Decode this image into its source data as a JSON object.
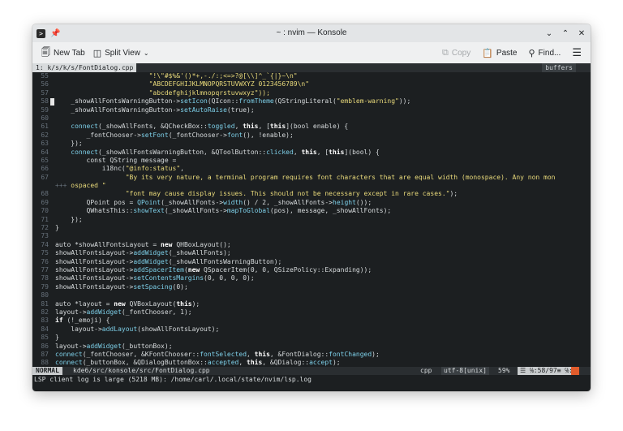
{
  "window": {
    "title": "~ : nvim — Konsole"
  },
  "toolbar": {
    "new_tab": "New Tab",
    "split_view": "Split View",
    "copy": "Copy",
    "paste": "Paste",
    "find": "Find..."
  },
  "tabline": {
    "active_tab": "1: k/s/k/s/FontDialog.cpp",
    "right_label": "buffers"
  },
  "editor": {
    "lines": [
      {
        "num": "55",
        "parts": [
          {
            "c": "str",
            "t": "                        \"!\\\"#$%&'()*+,-./:;<=>?@[\\\\]^_`{|}~\\n\""
          }
        ]
      },
      {
        "num": "56",
        "parts": [
          {
            "c": "str",
            "t": "                        \"ABCDEFGHIJKLMNOPQRSTUVWXYZ 0123456789\\n\""
          }
        ]
      },
      {
        "num": "57",
        "parts": [
          {
            "c": "str",
            "t": "                        \"abcdefghijklmnopqrstuvwxyz\"));"
          }
        ]
      },
      {
        "num": "58",
        "parts": [
          {
            "c": "txt",
            "t": "    _showAllFontsWarningButton->"
          },
          {
            "c": "fn",
            "t": "setIcon"
          },
          {
            "c": "txt",
            "t": "(QIcon::"
          },
          {
            "c": "fn",
            "t": "fromTheme"
          },
          {
            "c": "txt",
            "t": "(QStringLiteral("
          },
          {
            "c": "str",
            "t": "\"emblem-warning\""
          },
          {
            "c": "txt",
            "t": "));"
          }
        ]
      },
      {
        "num": "59",
        "parts": [
          {
            "c": "txt",
            "t": "    _showAllFontsWarningButton->"
          },
          {
            "c": "fn",
            "t": "setAutoRaise"
          },
          {
            "c": "txt",
            "t": "(true);"
          }
        ]
      },
      {
        "num": "60",
        "parts": []
      },
      {
        "num": "61",
        "parts": [
          {
            "c": "fn",
            "t": "    connect"
          },
          {
            "c": "txt",
            "t": "(_showAllFonts, &QCheckBox::"
          },
          {
            "c": "fn",
            "t": "toggled"
          },
          {
            "c": "txt",
            "t": ", "
          },
          {
            "c": "kw",
            "t": "this"
          },
          {
            "c": "txt",
            "t": ", ["
          },
          {
            "c": "kw",
            "t": "this"
          },
          {
            "c": "txt",
            "t": "](bool enable) {"
          }
        ]
      },
      {
        "num": "62",
        "parts": [
          {
            "c": "txt",
            "t": "        _fontChooser->"
          },
          {
            "c": "fn",
            "t": "setFont"
          },
          {
            "c": "txt",
            "t": "(_fontChooser->"
          },
          {
            "c": "fn",
            "t": "font"
          },
          {
            "c": "txt",
            "t": "(), !enable);"
          }
        ]
      },
      {
        "num": "63",
        "parts": [
          {
            "c": "txt",
            "t": "    });"
          }
        ]
      },
      {
        "num": "64",
        "parts": [
          {
            "c": "fn",
            "t": "    connect"
          },
          {
            "c": "txt",
            "t": "(_showAllFontsWarningButton, &QToolButton::"
          },
          {
            "c": "fn",
            "t": "clicked"
          },
          {
            "c": "txt",
            "t": ", "
          },
          {
            "c": "kw",
            "t": "this"
          },
          {
            "c": "txt",
            "t": ", ["
          },
          {
            "c": "kw",
            "t": "this"
          },
          {
            "c": "txt",
            "t": "](bool) {"
          }
        ]
      },
      {
        "num": "65",
        "parts": [
          {
            "c": "txt",
            "t": "        const QString message ="
          }
        ]
      },
      {
        "num": "66",
        "parts": [
          {
            "c": "txt",
            "t": "            i18nc("
          },
          {
            "c": "str",
            "t": "\"@info:status\""
          },
          {
            "c": "txt",
            "t": ","
          }
        ]
      },
      {
        "num": "67",
        "parts": [
          {
            "c": "str",
            "t": "                  \"By its very nature, a terminal program requires font characters that are equal width (monospace). Any non mon"
          }
        ]
      },
      {
        "num": "",
        "wrap": true,
        "parts": [
          {
            "c": "wrap-mark",
            "t": "+++ "
          },
          {
            "c": "str",
            "t": "ospaced \""
          }
        ]
      },
      {
        "num": "68",
        "parts": [
          {
            "c": "str",
            "t": "                  \"font may cause display issues. This should not be necessary except in rare cases.\""
          },
          {
            "c": "txt",
            "t": ");"
          }
        ]
      },
      {
        "num": "69",
        "parts": [
          {
            "c": "txt",
            "t": "        QPoint pos = "
          },
          {
            "c": "fn",
            "t": "QPoint"
          },
          {
            "c": "txt",
            "t": "(_showAllFonts->"
          },
          {
            "c": "fn",
            "t": "width"
          },
          {
            "c": "txt",
            "t": "() / 2, _showAllFonts->"
          },
          {
            "c": "fn",
            "t": "height"
          },
          {
            "c": "txt",
            "t": "());"
          }
        ]
      },
      {
        "num": "70",
        "parts": [
          {
            "c": "txt",
            "t": "        QWhatsThis::"
          },
          {
            "c": "fn",
            "t": "showText"
          },
          {
            "c": "txt",
            "t": "(_showAllFonts->"
          },
          {
            "c": "fn",
            "t": "mapToGlobal"
          },
          {
            "c": "txt",
            "t": "(pos), message, _showAllFonts);"
          }
        ]
      },
      {
        "num": "71",
        "parts": [
          {
            "c": "txt",
            "t": "    });"
          }
        ]
      },
      {
        "num": "72",
        "parts": [
          {
            "c": "txt",
            "t": "}"
          }
        ]
      },
      {
        "num": "73",
        "parts": []
      },
      {
        "num": "74",
        "parts": [
          {
            "c": "txt",
            "t": "auto *showAllFontsLayout = "
          },
          {
            "c": "kw",
            "t": "new"
          },
          {
            "c": "txt",
            "t": " QHBoxLayout();"
          }
        ]
      },
      {
        "num": "75",
        "parts": [
          {
            "c": "txt",
            "t": "showAllFontsLayout->"
          },
          {
            "c": "fn",
            "t": "addWidget"
          },
          {
            "c": "txt",
            "t": "(_showAllFonts);"
          }
        ]
      },
      {
        "num": "76",
        "parts": [
          {
            "c": "txt",
            "t": "showAllFontsLayout->"
          },
          {
            "c": "fn",
            "t": "addWidget"
          },
          {
            "c": "txt",
            "t": "(_showAllFontsWarningButton);"
          }
        ]
      },
      {
        "num": "77",
        "parts": [
          {
            "c": "txt",
            "t": "showAllFontsLayout->"
          },
          {
            "c": "fn",
            "t": "addSpacerItem"
          },
          {
            "c": "txt",
            "t": "("
          },
          {
            "c": "kw",
            "t": "new"
          },
          {
            "c": "txt",
            "t": " QSpacerItem(0, 0, QSizePolicy::Expanding));"
          }
        ]
      },
      {
        "num": "78",
        "parts": [
          {
            "c": "txt",
            "t": "showAllFontsLayout->"
          },
          {
            "c": "fn",
            "t": "setContentsMargins"
          },
          {
            "c": "txt",
            "t": "(0, 0, 0, 0);"
          }
        ]
      },
      {
        "num": "79",
        "parts": [
          {
            "c": "txt",
            "t": "showAllFontsLayout->"
          },
          {
            "c": "fn",
            "t": "setSpacing"
          },
          {
            "c": "txt",
            "t": "(0);"
          }
        ]
      },
      {
        "num": "80",
        "parts": []
      },
      {
        "num": "81",
        "parts": [
          {
            "c": "txt",
            "t": "auto *layout = "
          },
          {
            "c": "kw",
            "t": "new"
          },
          {
            "c": "txt",
            "t": " QVBoxLayout("
          },
          {
            "c": "kw",
            "t": "this"
          },
          {
            "c": "txt",
            "t": ");"
          }
        ]
      },
      {
        "num": "82",
        "parts": [
          {
            "c": "txt",
            "t": "layout->"
          },
          {
            "c": "fn",
            "t": "addWidget"
          },
          {
            "c": "txt",
            "t": "(_fontChooser, 1);"
          }
        ]
      },
      {
        "num": "83",
        "parts": [
          {
            "c": "kw",
            "t": "if"
          },
          {
            "c": "txt",
            "t": " (!_emoji) {"
          }
        ]
      },
      {
        "num": "84",
        "parts": [
          {
            "c": "txt",
            "t": "    layout->"
          },
          {
            "c": "fn",
            "t": "addLayout"
          },
          {
            "c": "txt",
            "t": "(showAllFontsLayout);"
          }
        ]
      },
      {
        "num": "85",
        "parts": [
          {
            "c": "txt",
            "t": "}"
          }
        ]
      },
      {
        "num": "86",
        "parts": [
          {
            "c": "txt",
            "t": "layout->"
          },
          {
            "c": "fn",
            "t": "addWidget"
          },
          {
            "c": "txt",
            "t": "(_buttonBox);"
          }
        ]
      },
      {
        "num": "87",
        "parts": [
          {
            "c": "fn",
            "t": "connect"
          },
          {
            "c": "txt",
            "t": "(_fontChooser, &KFontChooser::"
          },
          {
            "c": "fn",
            "t": "fontSelected"
          },
          {
            "c": "txt",
            "t": ", "
          },
          {
            "c": "kw",
            "t": "this"
          },
          {
            "c": "txt",
            "t": ", &FontDialog::"
          },
          {
            "c": "fn",
            "t": "fontChanged"
          },
          {
            "c": "txt",
            "t": ");"
          }
        ]
      },
      {
        "num": "88",
        "parts": [
          {
            "c": "fn",
            "t": "connect"
          },
          {
            "c": "txt",
            "t": "(_buttonBox, &QDialogButtonBox::"
          },
          {
            "c": "fn",
            "t": "accepted"
          },
          {
            "c": "txt",
            "t": ", "
          },
          {
            "c": "kw",
            "t": "this"
          },
          {
            "c": "txt",
            "t": ", &QDialog::"
          },
          {
            "c": "fn",
            "t": "accept"
          },
          {
            "c": "txt",
            "t": ");"
          }
        ]
      }
    ]
  },
  "statusline": {
    "mode": "NORMAL",
    "file": "kde6/src/konsole/src/FontDialog.cpp",
    "filetype": "cpp",
    "encoding": "utf-8[unix]",
    "percent": "59%",
    "position": "☰ ℅:58/97≡ ℅:1"
  },
  "cmdline": "LSP client log is large (5218 MB): /home/carl/.local/state/nvim/lsp.log",
  "icons": {
    "app": "konsole-icon",
    "pin": "pin-icon",
    "new_tab": "new-tab-icon",
    "split_view": "split-view-icon",
    "copy": "copy-icon",
    "paste": "paste-icon",
    "find": "search-icon",
    "menu": "hamburger-menu-icon"
  }
}
